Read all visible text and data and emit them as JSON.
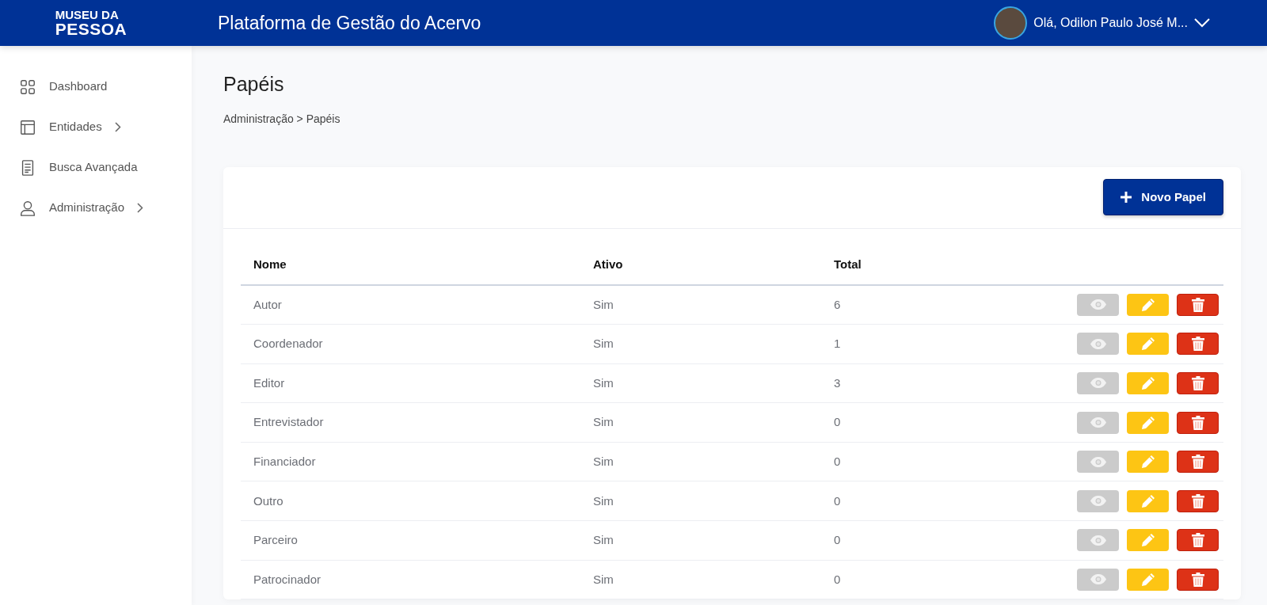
{
  "header": {
    "logo": [
      "MUSEU DA",
      "PESSOA"
    ],
    "title": "Plataforma de Gestão do Acervo",
    "user": "Olá, Odilon Paulo José M..."
  },
  "sidebar": {
    "items": [
      {
        "label": "Dashboard",
        "expandable": false
      },
      {
        "label": "Entidades",
        "expandable": true
      },
      {
        "label": "Busca Avançada",
        "expandable": false
      },
      {
        "label": "Administração",
        "expandable": true
      }
    ]
  },
  "page": {
    "title": "Papéis",
    "breadcrumb": "Administração > Papéis"
  },
  "new_button": "Novo Papel",
  "table": {
    "columns": [
      "Nome",
      "Ativo",
      "Total"
    ],
    "rows": [
      {
        "nome": "Autor",
        "ativo": "Sim",
        "total": "6"
      },
      {
        "nome": "Coordenador",
        "ativo": "Sim",
        "total": "1"
      },
      {
        "nome": "Editor",
        "ativo": "Sim",
        "total": "3"
      },
      {
        "nome": "Entrevistador",
        "ativo": "Sim",
        "total": "0"
      },
      {
        "nome": "Financiador",
        "ativo": "Sim",
        "total": "0"
      },
      {
        "nome": "Outro",
        "ativo": "Sim",
        "total": "0"
      },
      {
        "nome": "Parceiro",
        "ativo": "Sim",
        "total": "0"
      },
      {
        "nome": "Patrocinador",
        "ativo": "Sim",
        "total": "0"
      }
    ]
  }
}
